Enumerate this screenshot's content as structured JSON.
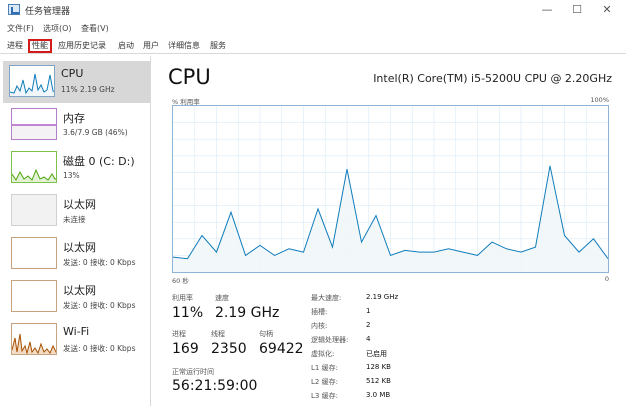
{
  "window": {
    "title": "任务管理器"
  },
  "menu": [
    "文件(F)",
    "选项(O)",
    "查看(V)"
  ],
  "tabs": [
    {
      "label": "进程",
      "active": false
    },
    {
      "label": "性能",
      "active": true
    },
    {
      "label": "应用历史记录",
      "active": false
    },
    {
      "label": "启动",
      "active": false
    },
    {
      "label": "用户",
      "active": false
    },
    {
      "label": "详细信息",
      "active": false
    },
    {
      "label": "服务",
      "active": false
    }
  ],
  "sidebar": [
    {
      "title": "CPU",
      "sub": "11% 2.19 GHz",
      "selected": true,
      "color": "#117dbb",
      "fill": "#f1f6fa"
    },
    {
      "title": "内存",
      "sub": "3.6/7.9 GB (46%)",
      "selected": false,
      "color": "#8b12ae",
      "fill": "#f4f2f4"
    },
    {
      "title": "磁盘 0 (C: D:)",
      "sub": "13%",
      "selected": false,
      "color": "#4da60c",
      "fill": "#eff7e8"
    },
    {
      "title": "以太网",
      "sub": "未连接",
      "selected": false,
      "color": "#a74f01",
      "fill": "#f2f2f2"
    },
    {
      "title": "以太网",
      "sub": "发送: 0 接收: 0 Kbps",
      "selected": false,
      "color": "#a74f01",
      "fill": "#ffffff"
    },
    {
      "title": "以太网",
      "sub": "发送: 0 接收: 0 Kbps",
      "selected": false,
      "color": "#a74f01",
      "fill": "#ffffff"
    },
    {
      "title": "Wi-Fi",
      "sub": "发送: 0 接收: 0 Kbps",
      "selected": false,
      "color": "#a74f01",
      "fill": "#fcf3eb"
    }
  ],
  "main": {
    "title": "CPU",
    "model": "Intel(R) Core(TM) i5-5200U CPU @ 2.20GHz",
    "graph_top_left": "% 利用率",
    "graph_top_right": "100%",
    "graph_bottom_left": "60 秒",
    "graph_bottom_right": "0"
  },
  "chart_data": {
    "type": "area",
    "x": [
      60,
      58,
      56,
      54,
      52,
      50,
      48,
      46,
      44,
      42,
      40,
      38,
      36,
      34,
      32,
      30,
      28,
      26,
      24,
      22,
      20,
      18,
      16,
      14,
      12,
      10,
      8,
      6,
      4,
      2,
      0
    ],
    "values": [
      9,
      8,
      22,
      12,
      36,
      10,
      16,
      10,
      14,
      12,
      38,
      15,
      62,
      18,
      34,
      10,
      13,
      12,
      12,
      14,
      12,
      10,
      18,
      14,
      12,
      15,
      64,
      22,
      12,
      20,
      8
    ],
    "ylim": [
      0,
      100
    ],
    "color": "#117dbb",
    "fill": "#f1f6fa"
  },
  "stats": {
    "util_label": "利用率",
    "util_value": "11%",
    "speed_label": "速度",
    "speed_value": "2.19 GHz",
    "proc_label": "进程",
    "proc_value": "169",
    "thread_label": "线程",
    "thread_value": "2350",
    "handle_label": "句柄",
    "handle_value": "69422",
    "uptime_label": "正常运行时间",
    "uptime_value": "56:21:59:00"
  },
  "specs": [
    {
      "key": "最大速度:",
      "val": "2.19 GHz"
    },
    {
      "key": "插槽:",
      "val": "1"
    },
    {
      "key": "内核:",
      "val": "2"
    },
    {
      "key": "逻辑处理器:",
      "val": "4"
    },
    {
      "key": "虚拟化:",
      "val": "已启用"
    },
    {
      "key": "L1 缓存:",
      "val": "128 KB"
    },
    {
      "key": "L2 缓存:",
      "val": "512 KB"
    },
    {
      "key": "L3 缓存:",
      "val": "3.0 MB"
    }
  ]
}
